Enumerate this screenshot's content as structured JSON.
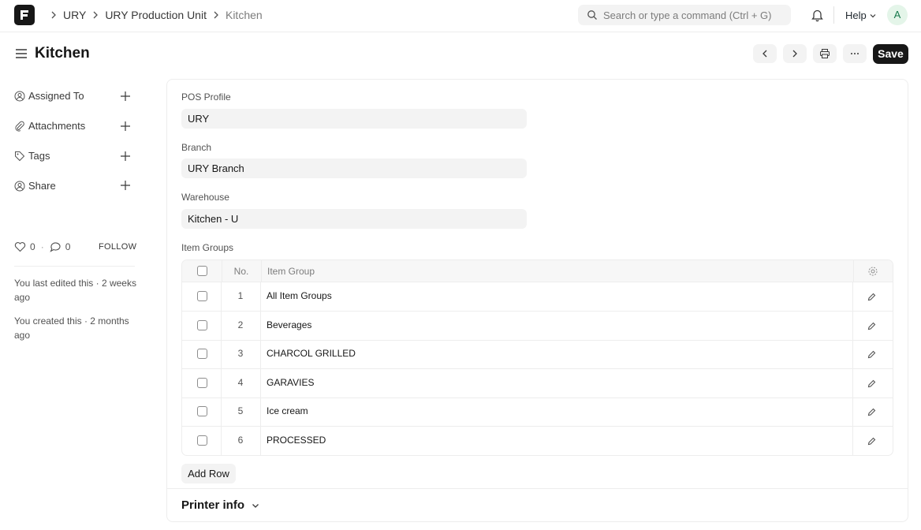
{
  "navbar": {
    "breadcrumbs": [
      "URY",
      "URY Production Unit",
      "Kitchen"
    ],
    "search_placeholder": "Search or type a command (Ctrl + G)",
    "help_label": "Help",
    "avatar_initial": "A"
  },
  "page": {
    "title": "Kitchen",
    "save_label": "Save"
  },
  "sidebar": {
    "items": [
      {
        "label": "Assigned To",
        "icon": "assign-icon"
      },
      {
        "label": "Attachments",
        "icon": "paperclip-icon"
      },
      {
        "label": "Tags",
        "icon": "tag-icon"
      },
      {
        "label": "Share",
        "icon": "share-icon"
      }
    ],
    "likes": "0",
    "comments": "0",
    "follow_label": "FOLLOW",
    "last_edited": "You last edited this · 2 weeks ago",
    "created": "You created this · 2 months ago"
  },
  "form": {
    "pos_profile": {
      "label": "POS Profile",
      "value": "URY"
    },
    "branch": {
      "label": "Branch",
      "value": "URY Branch"
    },
    "warehouse": {
      "label": "Warehouse",
      "value": "Kitchen - U"
    },
    "item_groups": {
      "label": "Item Groups",
      "columns": {
        "no": "No.",
        "item_group": "Item Group"
      },
      "rows": [
        {
          "no": "1",
          "item_group": "All Item Groups"
        },
        {
          "no": "2",
          "item_group": "Beverages"
        },
        {
          "no": "3",
          "item_group": "CHARCOL GRILLED"
        },
        {
          "no": "4",
          "item_group": "GARAVIES"
        },
        {
          "no": "5",
          "item_group": "Ice cream"
        },
        {
          "no": "6",
          "item_group": "PROCESSED"
        }
      ],
      "add_row_label": "Add Row"
    },
    "printer_section": "Printer info"
  },
  "colors": {
    "primary_button": "#171717",
    "control_bg": "#f3f3f3",
    "border": "#ededed"
  }
}
